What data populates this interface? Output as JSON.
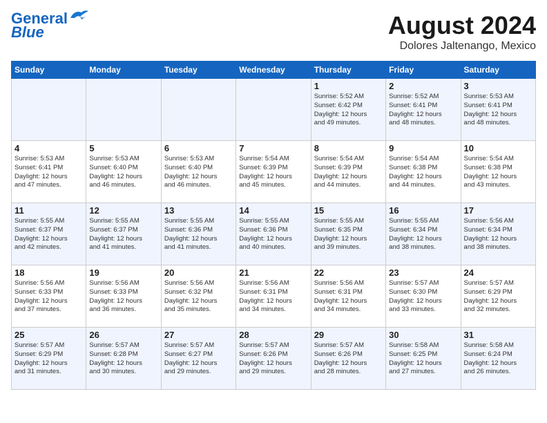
{
  "logo": {
    "line1": "General",
    "line2": "Blue"
  },
  "title": {
    "month": "August 2024",
    "location": "Dolores Jaltenango, Mexico"
  },
  "headers": [
    "Sunday",
    "Monday",
    "Tuesday",
    "Wednesday",
    "Thursday",
    "Friday",
    "Saturday"
  ],
  "weeks": [
    [
      {
        "day": "",
        "info": ""
      },
      {
        "day": "",
        "info": ""
      },
      {
        "day": "",
        "info": ""
      },
      {
        "day": "",
        "info": ""
      },
      {
        "day": "1",
        "info": "Sunrise: 5:52 AM\nSunset: 6:42 PM\nDaylight: 12 hours\nand 49 minutes."
      },
      {
        "day": "2",
        "info": "Sunrise: 5:52 AM\nSunset: 6:41 PM\nDaylight: 12 hours\nand 48 minutes."
      },
      {
        "day": "3",
        "info": "Sunrise: 5:53 AM\nSunset: 6:41 PM\nDaylight: 12 hours\nand 48 minutes."
      }
    ],
    [
      {
        "day": "4",
        "info": "Sunrise: 5:53 AM\nSunset: 6:41 PM\nDaylight: 12 hours\nand 47 minutes."
      },
      {
        "day": "5",
        "info": "Sunrise: 5:53 AM\nSunset: 6:40 PM\nDaylight: 12 hours\nand 46 minutes."
      },
      {
        "day": "6",
        "info": "Sunrise: 5:53 AM\nSunset: 6:40 PM\nDaylight: 12 hours\nand 46 minutes."
      },
      {
        "day": "7",
        "info": "Sunrise: 5:54 AM\nSunset: 6:39 PM\nDaylight: 12 hours\nand 45 minutes."
      },
      {
        "day": "8",
        "info": "Sunrise: 5:54 AM\nSunset: 6:39 PM\nDaylight: 12 hours\nand 44 minutes."
      },
      {
        "day": "9",
        "info": "Sunrise: 5:54 AM\nSunset: 6:38 PM\nDaylight: 12 hours\nand 44 minutes."
      },
      {
        "day": "10",
        "info": "Sunrise: 5:54 AM\nSunset: 6:38 PM\nDaylight: 12 hours\nand 43 minutes."
      }
    ],
    [
      {
        "day": "11",
        "info": "Sunrise: 5:55 AM\nSunset: 6:37 PM\nDaylight: 12 hours\nand 42 minutes."
      },
      {
        "day": "12",
        "info": "Sunrise: 5:55 AM\nSunset: 6:37 PM\nDaylight: 12 hours\nand 41 minutes."
      },
      {
        "day": "13",
        "info": "Sunrise: 5:55 AM\nSunset: 6:36 PM\nDaylight: 12 hours\nand 41 minutes."
      },
      {
        "day": "14",
        "info": "Sunrise: 5:55 AM\nSunset: 6:36 PM\nDaylight: 12 hours\nand 40 minutes."
      },
      {
        "day": "15",
        "info": "Sunrise: 5:55 AM\nSunset: 6:35 PM\nDaylight: 12 hours\nand 39 minutes."
      },
      {
        "day": "16",
        "info": "Sunrise: 5:55 AM\nSunset: 6:34 PM\nDaylight: 12 hours\nand 38 minutes."
      },
      {
        "day": "17",
        "info": "Sunrise: 5:56 AM\nSunset: 6:34 PM\nDaylight: 12 hours\nand 38 minutes."
      }
    ],
    [
      {
        "day": "18",
        "info": "Sunrise: 5:56 AM\nSunset: 6:33 PM\nDaylight: 12 hours\nand 37 minutes."
      },
      {
        "day": "19",
        "info": "Sunrise: 5:56 AM\nSunset: 6:33 PM\nDaylight: 12 hours\nand 36 minutes."
      },
      {
        "day": "20",
        "info": "Sunrise: 5:56 AM\nSunset: 6:32 PM\nDaylight: 12 hours\nand 35 minutes."
      },
      {
        "day": "21",
        "info": "Sunrise: 5:56 AM\nSunset: 6:31 PM\nDaylight: 12 hours\nand 34 minutes."
      },
      {
        "day": "22",
        "info": "Sunrise: 5:56 AM\nSunset: 6:31 PM\nDaylight: 12 hours\nand 34 minutes."
      },
      {
        "day": "23",
        "info": "Sunrise: 5:57 AM\nSunset: 6:30 PM\nDaylight: 12 hours\nand 33 minutes."
      },
      {
        "day": "24",
        "info": "Sunrise: 5:57 AM\nSunset: 6:29 PM\nDaylight: 12 hours\nand 32 minutes."
      }
    ],
    [
      {
        "day": "25",
        "info": "Sunrise: 5:57 AM\nSunset: 6:29 PM\nDaylight: 12 hours\nand 31 minutes."
      },
      {
        "day": "26",
        "info": "Sunrise: 5:57 AM\nSunset: 6:28 PM\nDaylight: 12 hours\nand 30 minutes."
      },
      {
        "day": "27",
        "info": "Sunrise: 5:57 AM\nSunset: 6:27 PM\nDaylight: 12 hours\nand 29 minutes."
      },
      {
        "day": "28",
        "info": "Sunrise: 5:57 AM\nSunset: 6:26 PM\nDaylight: 12 hours\nand 29 minutes."
      },
      {
        "day": "29",
        "info": "Sunrise: 5:57 AM\nSunset: 6:26 PM\nDaylight: 12 hours\nand 28 minutes."
      },
      {
        "day": "30",
        "info": "Sunrise: 5:58 AM\nSunset: 6:25 PM\nDaylight: 12 hours\nand 27 minutes."
      },
      {
        "day": "31",
        "info": "Sunrise: 5:58 AM\nSunset: 6:24 PM\nDaylight: 12 hours\nand 26 minutes."
      }
    ]
  ]
}
